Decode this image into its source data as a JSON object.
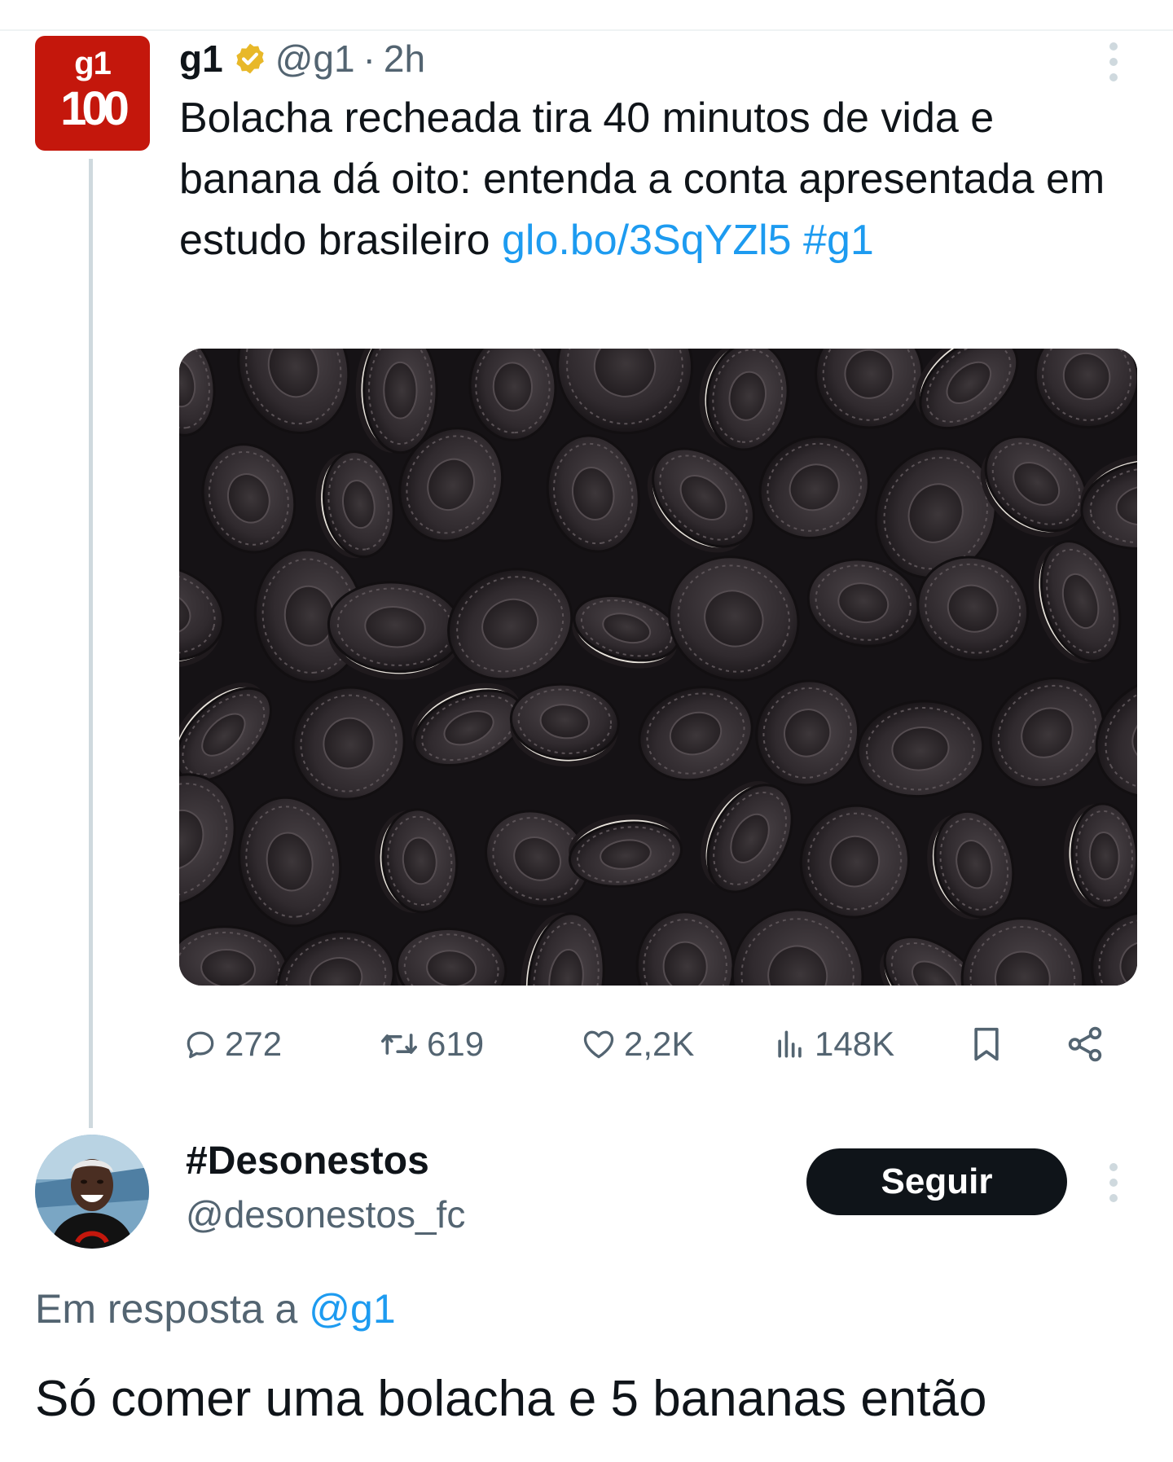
{
  "tweet": {
    "avatar_top": "g1",
    "avatar_bottom": "100",
    "name": "g1",
    "handle": "@g1",
    "separator": "·",
    "time": "2h",
    "text": "Bolacha recheada tira 40 minutos de vida e banana dá oito: entenda a conta apresentada em estudo brasileiro",
    "link": "glo.bo/3SqYZl5",
    "hashtag": "#g1",
    "image_description_icon": "oreo-cookies-photo",
    "stats": {
      "replies": "272",
      "retweets": "619",
      "likes": "2,2K",
      "views": "148K"
    }
  },
  "reply": {
    "name": "#Desonestos",
    "handle": "@desonestos_fc",
    "follow_label": "Seguir",
    "reply_to_prefix": "Em resposta a",
    "reply_to_handle": "@g1",
    "text": "Só comer uma bolacha e 5 bananas então"
  },
  "colors": {
    "brand_red": "#c4170c",
    "link_blue": "#1d9bf0",
    "muted": "#536471",
    "verified_gold": "#e8b829"
  }
}
